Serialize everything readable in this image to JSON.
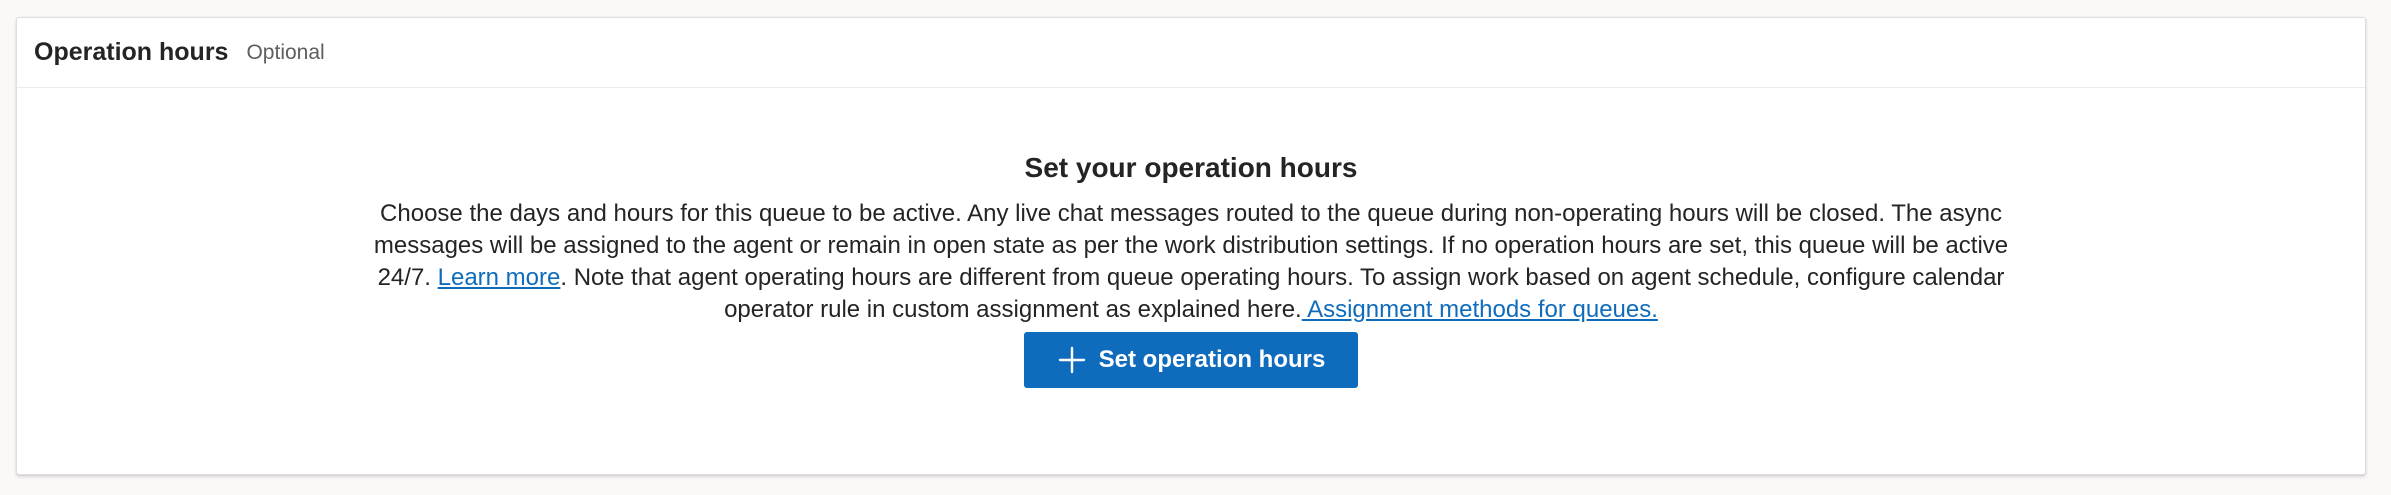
{
  "section": {
    "title": "Operation hours",
    "optional_label": "Optional"
  },
  "empty_state": {
    "title": "Set your operation hours",
    "description_part1": "Choose the days and hours for this queue to be active. Any live chat messages routed to the queue during non-operating hours will be closed. The async messages will be assigned to the agent or remain in open state as per the work distribution settings. If no operation hours are set, this queue will be active 24/7. ",
    "learn_more_link": "Learn more",
    "description_part2": ". Note that agent operating hours are different from queue operating hours. To assign work based on agent schedule, configure calendar operator rule in custom assignment as explained here.",
    "assignment_link": " Assignment methods for queues.",
    "button_label": "Set operation hours",
    "button_icon": "plus-icon"
  },
  "colors": {
    "accent": "#0f6cbd",
    "background": "#faf9f8",
    "card": "#ffffff"
  }
}
